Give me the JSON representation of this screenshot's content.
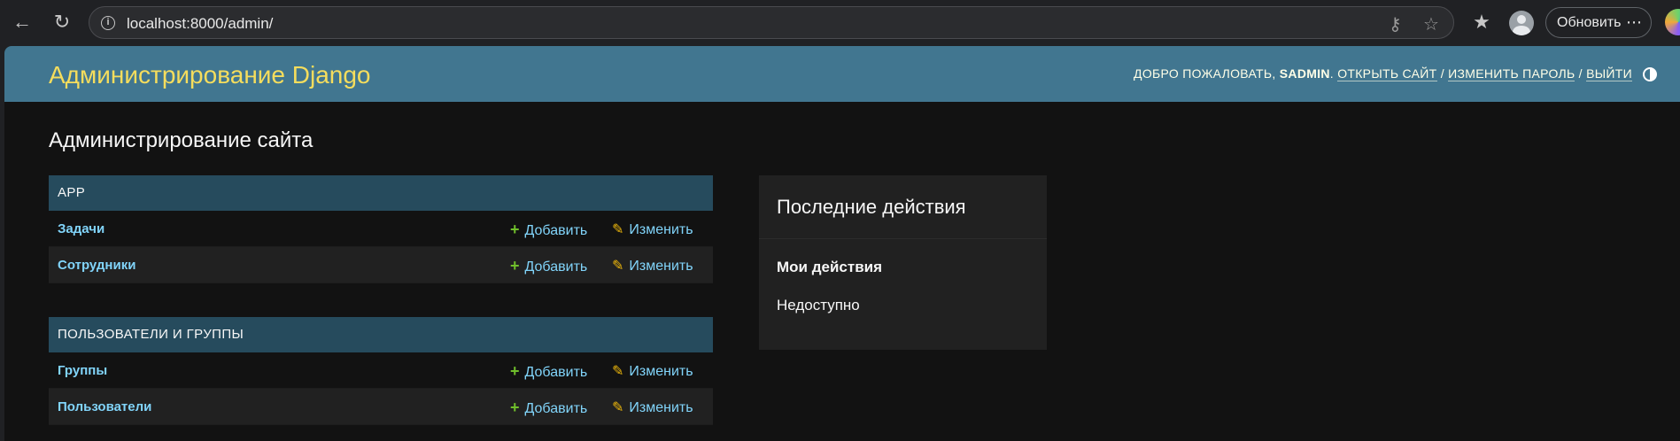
{
  "browser": {
    "back_icon": "arrow-left-icon",
    "reload_icon": "reload-icon",
    "url": "localhost:8000/admin/",
    "update_label": "Обновить"
  },
  "header": {
    "site_name": "Администрирование Django",
    "welcome": "ДОБРО ПОЖАЛОВАТЬ,",
    "username": "SADMIN",
    "view_site": "ОТКРЫТЬ САЙТ",
    "change_password": "ИЗМЕНИТЬ ПАРОЛЬ",
    "logout": "ВЫЙТИ",
    "separator": "/"
  },
  "content": {
    "title": "Администрирование сайта"
  },
  "modules": [
    {
      "caption": "APP",
      "models": [
        {
          "name": "Задачи",
          "add": "Добавить",
          "change": "Изменить"
        },
        {
          "name": "Сотрудники",
          "add": "Добавить",
          "change": "Изменить"
        }
      ]
    },
    {
      "caption": "ПОЛЬЗОВАТЕЛИ И ГРУППЫ",
      "models": [
        {
          "name": "Группы",
          "add": "Добавить",
          "change": "Изменить"
        },
        {
          "name": "Пользователи",
          "add": "Добавить",
          "change": "Изменить"
        }
      ]
    }
  ],
  "recent_actions": {
    "title": "Последние действия",
    "my_actions": "Мои действия",
    "none_available": "Недоступно"
  },
  "colors": {
    "header_bg": "#417690",
    "branding": "#f5dd5d",
    "module_caption_bg": "#264b5d",
    "link": "#81d4fa",
    "add_icon": "#70bf2b",
    "change_icon": "#efb80b"
  }
}
